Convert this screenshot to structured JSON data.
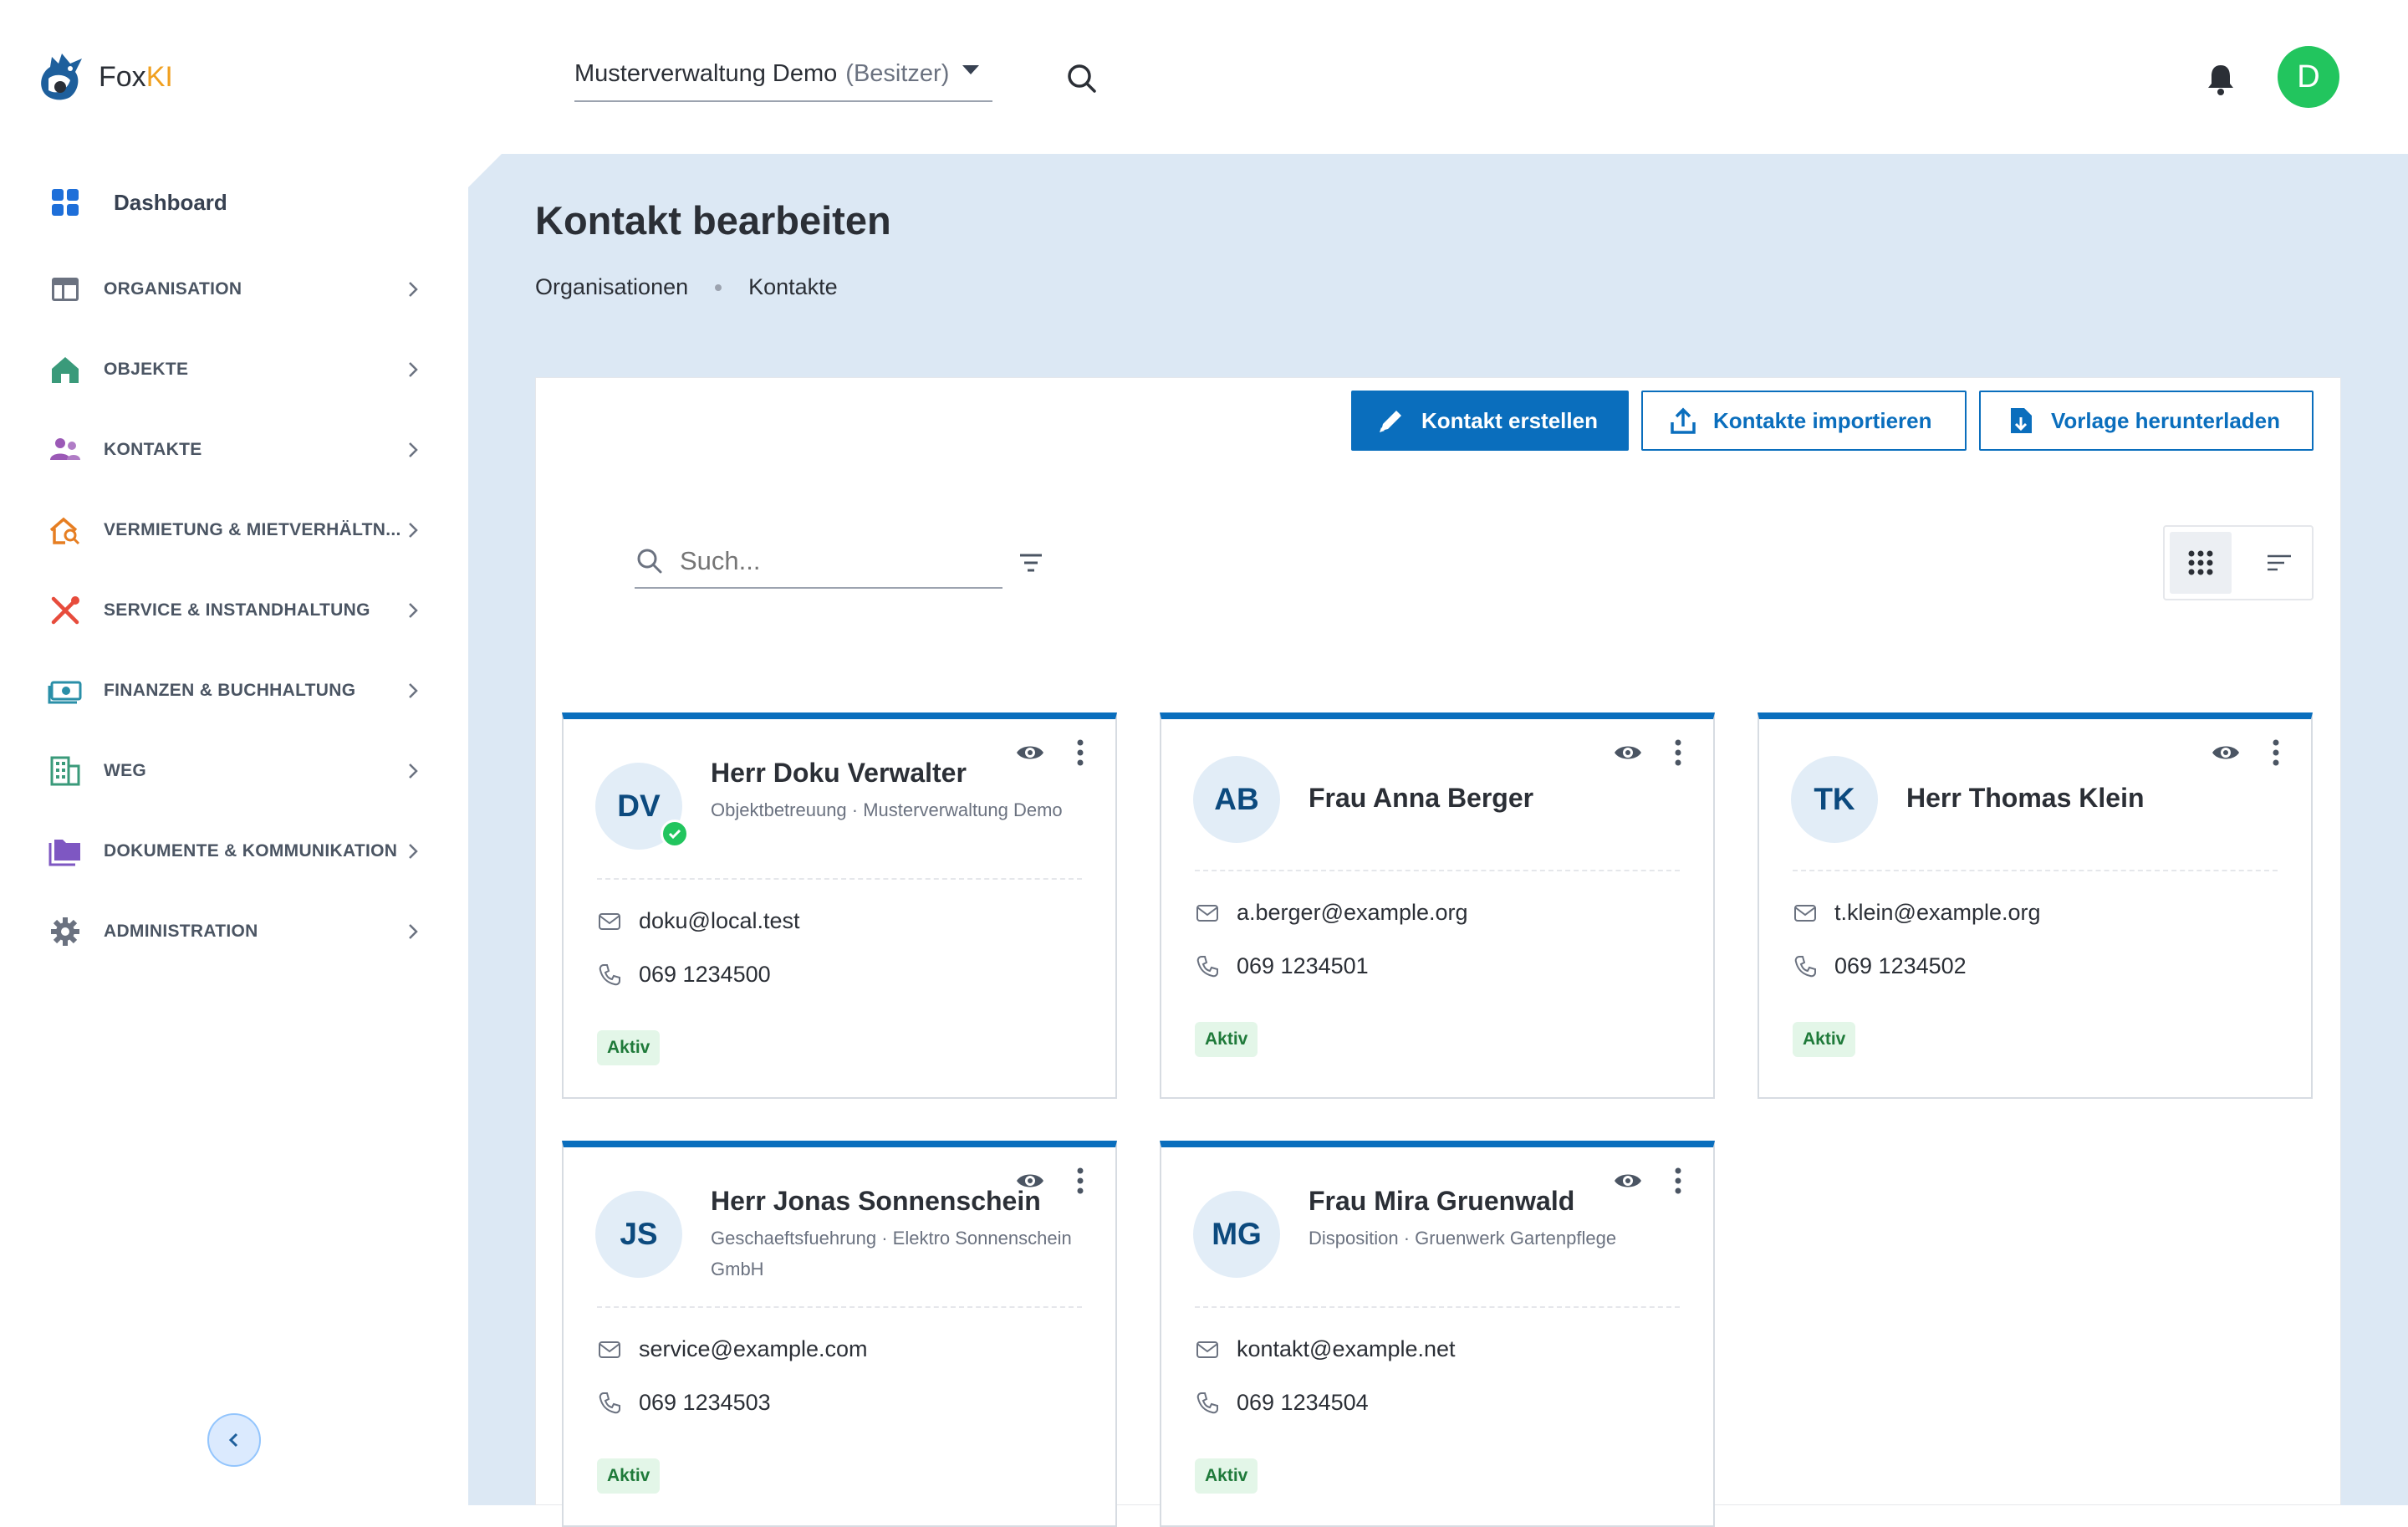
{
  "app": {
    "logo_text_main": "Fox",
    "logo_text_accent": "KI",
    "org_selector": {
      "name": "Musterverwaltung Demo",
      "role": "(Besitzer)"
    },
    "user_initial": "D"
  },
  "sidebar": {
    "dashboard_label": "Dashboard",
    "items": [
      {
        "label": "ORGANISATION",
        "icon": "layout-icon",
        "color": "#4b5563"
      },
      {
        "label": "OBJEKTE",
        "icon": "home-icon",
        "color": "#3a9a7a"
      },
      {
        "label": "KONTAKTE",
        "icon": "people-icon",
        "color": "#9b59b6"
      },
      {
        "label": "VERMIETUNG & MIETVERHÄLTN...",
        "icon": "house-search-icon",
        "color": "#e67e22"
      },
      {
        "label": "SERVICE & INSTANDHALTUNG",
        "icon": "tools-icon",
        "color": "#e74c3c"
      },
      {
        "label": "FINANZEN & BUCHHALTUNG",
        "icon": "money-icon",
        "color": "#2a8fa8"
      },
      {
        "label": "WEG",
        "icon": "building-icon",
        "color": "#3a9a7a"
      },
      {
        "label": "DOKUMENTE & KOMMUNIKATION",
        "icon": "folder-icon",
        "color": "#7e57c2"
      },
      {
        "label": "ADMINISTRATION",
        "icon": "gear-icon",
        "color": "#6b7280"
      }
    ]
  },
  "page": {
    "title": "Kontakt bearbeiten",
    "breadcrumb": [
      "Organisationen",
      "Kontakte"
    ]
  },
  "toolbar": {
    "create_label": "Kontakt erstellen",
    "import_label": "Kontakte importieren",
    "template_label": "Vorlage herunterladen"
  },
  "search": {
    "placeholder": "Such..."
  },
  "contacts": [
    {
      "initials": "DV",
      "name": "Herr Doku Verwalter",
      "sub": "Objektbetreuung · Musterverwaltung Demo",
      "email": "doku@local.test",
      "phone": "069 1234500",
      "status": "Aktiv",
      "verified": true
    },
    {
      "initials": "AB",
      "name": "Frau Anna Berger",
      "sub": "",
      "email": "a.berger@example.org",
      "phone": "069 1234501",
      "status": "Aktiv",
      "verified": false
    },
    {
      "initials": "TK",
      "name": "Herr Thomas Klein",
      "sub": "",
      "email": "t.klein@example.org",
      "phone": "069 1234502",
      "status": "Aktiv",
      "verified": false
    },
    {
      "initials": "JS",
      "name": "Herr Jonas Sonnenschein",
      "sub": "Geschaeftsfuehrung · Elektro Sonnenschein GmbH",
      "email": "service@example.com",
      "phone": "069 1234503",
      "status": "Aktiv",
      "verified": false
    },
    {
      "initials": "MG",
      "name": "Frau Mira Gruenwald",
      "sub": "Disposition · Gruenwerk Gartenpflege",
      "email": "kontakt@example.net",
      "phone": "069 1234504",
      "status": "Aktiv",
      "verified": false
    }
  ],
  "colors": {
    "primary": "#0a6ebd",
    "main_bg": "#dce8f4",
    "active_badge": "#e3f6e8",
    "avatar": "#22c55e"
  }
}
